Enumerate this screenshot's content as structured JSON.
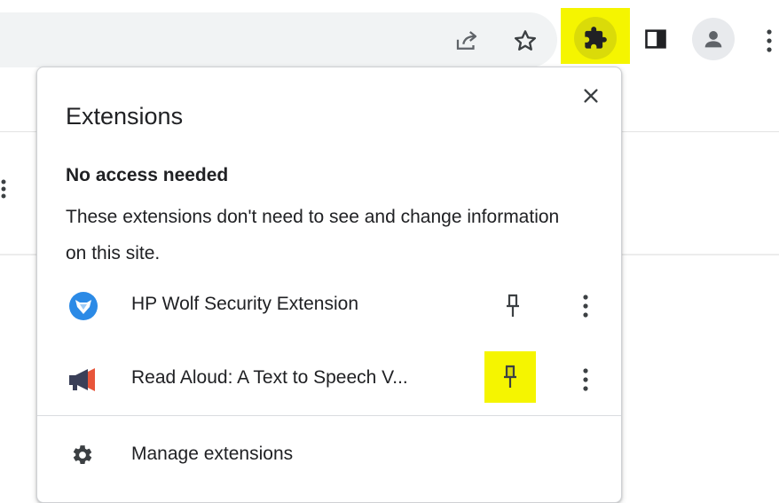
{
  "toolbar": {
    "icons": [
      "share-icon",
      "star-icon",
      "puzzle-icon",
      "side-panel-icon",
      "profile-icon",
      "more-vert-icon"
    ],
    "highlight_color": "#f5f500"
  },
  "popup": {
    "title": "Extensions",
    "close_icon": "close-icon",
    "section": {
      "heading": "No access needed",
      "description": "These extensions don't need to see and change information on this site."
    },
    "extensions": [
      {
        "name": "HP Wolf Security Extension",
        "icon": "hp-wolf-security-icon",
        "pinned": false,
        "icon_color": "#2b8ae6"
      },
      {
        "name": "Read Aloud: A Text to Speech V...",
        "icon": "megaphone-icon",
        "pinned": true,
        "icon_color": "#e8553a"
      }
    ],
    "manage": {
      "label": "Manage extensions",
      "icon": "gear-icon"
    }
  }
}
